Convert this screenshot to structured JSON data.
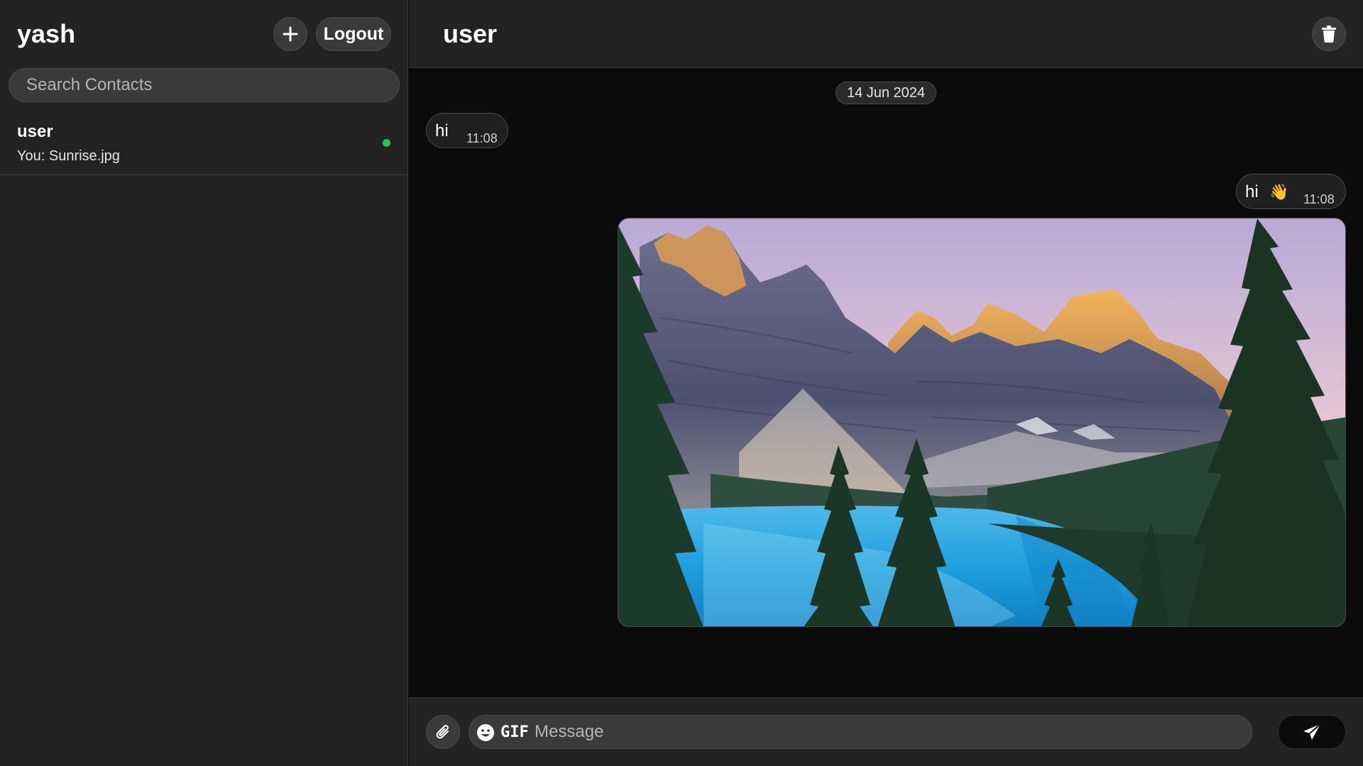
{
  "sidebar": {
    "current_user": "yash",
    "add_button_icon": "plus-icon",
    "logout_label": "Logout",
    "search_placeholder": "Search Contacts",
    "contacts": [
      {
        "name": "user",
        "last_message": "You: Sunrise.jpg",
        "status": "online",
        "status_color": "#22c55e"
      }
    ]
  },
  "chat": {
    "title": "user",
    "delete_icon": "trash-icon",
    "date_divider": "14 Jun 2024",
    "messages": [
      {
        "direction": "incoming",
        "text": "hi",
        "time": "11:08"
      },
      {
        "direction": "outgoing",
        "text": "hi",
        "emoji": "👋",
        "time": "11:08"
      },
      {
        "direction": "outgoing",
        "type": "image",
        "name": "Sunrise.jpg"
      }
    ]
  },
  "composer": {
    "attach_icon": "paperclip-icon",
    "emoji_icon": "smiley-icon",
    "gif_label": "GIF",
    "placeholder": "Message",
    "send_icon": "send-icon"
  },
  "colors": {
    "sidebar_bg": "#232323",
    "chat_bg": "#0b0b0b",
    "button_bg": "#3a3a3a",
    "online": "#22c55e"
  }
}
